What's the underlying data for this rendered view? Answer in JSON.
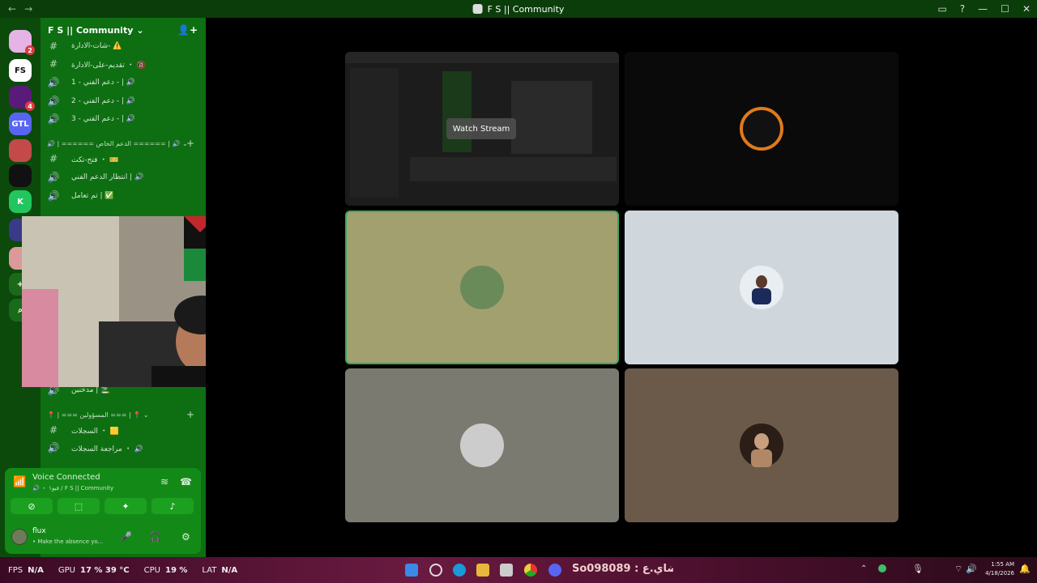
{
  "window": {
    "title": "F S || Community",
    "back": "←",
    "forward": "→"
  },
  "server": {
    "name": "F S || Community",
    "chevron": "⌄"
  },
  "rail": [
    {
      "badge": "2",
      "color": "#e6b3e6"
    },
    {
      "badge": "",
      "color": "#ffffff",
      "label": "FS"
    },
    {
      "badge": "4",
      "color": "#5a1a7a"
    },
    {
      "badge": "",
      "color": "#5865f2",
      "label": "GTL"
    },
    {
      "badge": "",
      "color": "#c44a4a"
    },
    {
      "badge": "",
      "color": "#111111"
    },
    {
      "badge": "",
      "color": "#22c55e",
      "label": "K"
    },
    {
      "badge": "",
      "color": "#3a3a8a"
    },
    {
      "badge": "",
      "color": "#d99"
    },
    {
      "badge": "",
      "color": "#1a6a1a",
      "label": "+"
    },
    {
      "badge": "",
      "color": "#1a6a1a",
      "label": "⌕"
    }
  ],
  "channels_top": [
    {
      "glyph": "#",
      "label": "شات-الادارة- ⚠️"
    },
    {
      "glyph": "#",
      "label": "تقديم-على-الادارة ・ 🔞"
    },
    {
      "glyph": "🔊",
      "label": "دعم الفني - 1 - | 🔊"
    },
    {
      "glyph": "🔊",
      "label": "دعم الفني - 2 - | 🔊"
    },
    {
      "glyph": "🔊",
      "label": "دعم الفني - 3 - | 🔊"
    }
  ],
  "category1": {
    "label": "🔊 | ====== الدعم الخاص ====== | 🔊"
  },
  "channels_mid": [
    {
      "glyph": "#",
      "label": "فتح-تكت ・ 🎫"
    },
    {
      "glyph": "🔊",
      "label": "انتظار الدعم الفني | 🔊"
    },
    {
      "glyph": "🔊",
      "label": "تم تعامل | ✅"
    }
  ],
  "channels_low": [
    {
      "glyph": "🔊",
      "label": "مدخنين | 🚬"
    }
  ],
  "category2": {
    "label": "📍 | === المسؤولين === | 📍"
  },
  "channels_bottom": [
    {
      "glyph": "#",
      "label": "السجلات ・ 🟨"
    },
    {
      "glyph": "🔊",
      "label": "مراجعة السجلات ・ 🔊"
    }
  ],
  "voice": {
    "status": "Voice Connected",
    "sub": "🔊 ・ فيو١ / F S || Community",
    "user": "flux",
    "user_status": "• Make the absence yo..."
  },
  "stage": {
    "watch_stream": "Watch Stream",
    "tiles": [
      {
        "bg": "#1a1a1a"
      },
      {
        "bg": "#0a0a0a"
      },
      {
        "bg": "#a3a070"
      },
      {
        "bg": "#d0d7dc"
      },
      {
        "bg": "#7a7a70"
      },
      {
        "bg": "#6b5a4a"
      }
    ]
  },
  "taskbar": {
    "fps_label": "FPS",
    "fps": "N/A",
    "gpu_label": "GPU",
    "gpu": "17 % 39 °C",
    "cpu_label": "CPU",
    "cpu": "19 %",
    "lat_label": "LAT",
    "lat": "N/A",
    "center_text": "So098089 : ضاي.ع",
    "time": "1:55 AM",
    "date": "4/18/2026"
  }
}
